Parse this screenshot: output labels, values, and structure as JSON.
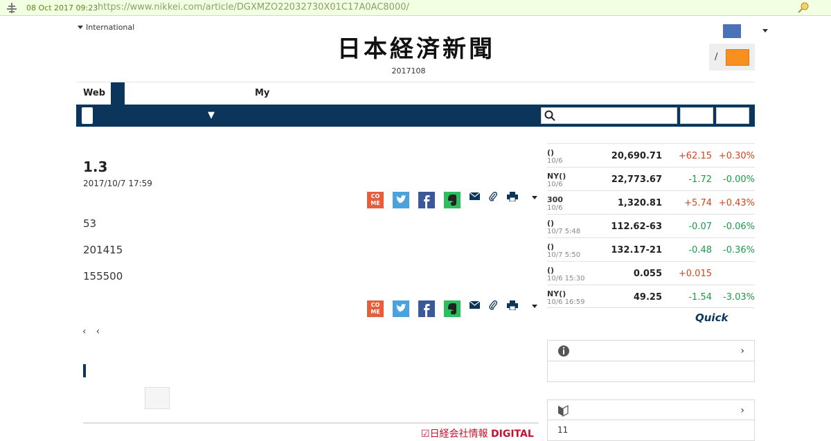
{
  "archive": {
    "date": "08 Oct 2017 09:23",
    "url": "https://www.nikkei.com/article/DGXMZO22032730X01C17A0AC8000/"
  },
  "header": {
    "international_label": "International",
    "masthead": "日本経済新聞",
    "edition": "2017108",
    "login_slash": "/"
  },
  "tabs": {
    "web_label": "Web",
    "my_label": "My"
  },
  "nav": {
    "dropdown_arrow": "▼",
    "search_placeholder": ""
  },
  "article": {
    "headline": "1.3",
    "date": "2017/10/7 17:59",
    "share_come_label": "CO\nME",
    "paragraphs": [
      "53",
      "201415",
      "155500"
    ]
  },
  "pager": {
    "prev1": "‹",
    "prev2": "‹"
  },
  "footer": {
    "digital_logo_prefix": "日経会社情報",
    "digital_logo_suffix": "DIGITAL"
  },
  "market": {
    "rows": [
      {
        "name": "()",
        "sub": "10/6",
        "value": "20,690.71",
        "change": "+62.15",
        "pct": "+0.30%",
        "dir": "up"
      },
      {
        "name": "NY()",
        "sub": "10/6",
        "value": "22,773.67",
        "change": "-1.72",
        "pct": "-0.00%",
        "dir": "down"
      },
      {
        "name": "300",
        "sub": "10/6",
        "value": "1,320.81",
        "change": "+5.74",
        "pct": "+0.43%",
        "dir": "up"
      },
      {
        "name": "()",
        "sub": "10/7 5:48",
        "value": "112.62-63",
        "change": "-0.07",
        "pct": "-0.06%",
        "dir": "down"
      },
      {
        "name": "()",
        "sub": "10/7 5:50",
        "value": "132.17-21",
        "change": "-0.48",
        "pct": "-0.36%",
        "dir": "down"
      },
      {
        "name": "()",
        "sub": "10/6 15:30",
        "value": "0.055",
        "change": "+0.015",
        "pct": "",
        "dir": "up"
      },
      {
        "name": "NY()",
        "sub": "10/6 16:59",
        "value": "49.25",
        "change": "-1.54",
        "pct": "-3.03%",
        "dir": "down"
      }
    ],
    "source_logo": "Quick"
  },
  "side": {
    "box1_chevron": "›",
    "box2_chevron": "›",
    "box2_number": "11"
  },
  "colors": {
    "navy": "#0b355a",
    "orange": "#f7901e",
    "user_blue": "#4a72b8",
    "up_red": "#d0451b",
    "down_green": "#1a9a4a"
  }
}
